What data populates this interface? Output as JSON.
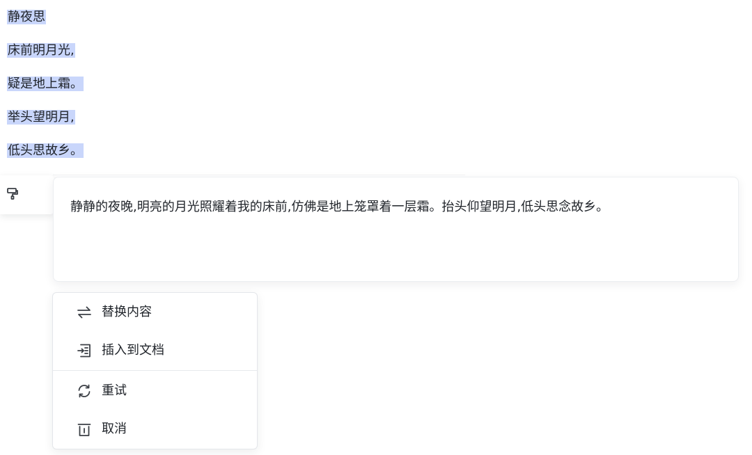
{
  "poem": {
    "lines": [
      "静夜思",
      "床前明月光,",
      "疑是地上霜。",
      "举头望明月,",
      "低头思故乡。"
    ]
  },
  "side_tool": {
    "icon": "format-painter-icon"
  },
  "result": {
    "text": "静静的夜晚,明亮的月光照耀着我的床前,仿佛是地上笼罩着一层霜。抬头仰望明月,低头思念故乡。"
  },
  "menu": {
    "items": [
      {
        "label": "替换内容",
        "icon": "swap-arrows-icon"
      },
      {
        "label": "插入到文档",
        "icon": "insert-document-icon"
      },
      {
        "label": "重试",
        "icon": "refresh-icon"
      },
      {
        "label": "取消",
        "icon": "trash-icon"
      }
    ]
  },
  "colors": {
    "selection": "#c9d6fb",
    "text": "#1f2329",
    "border": "#e4e6ea"
  }
}
